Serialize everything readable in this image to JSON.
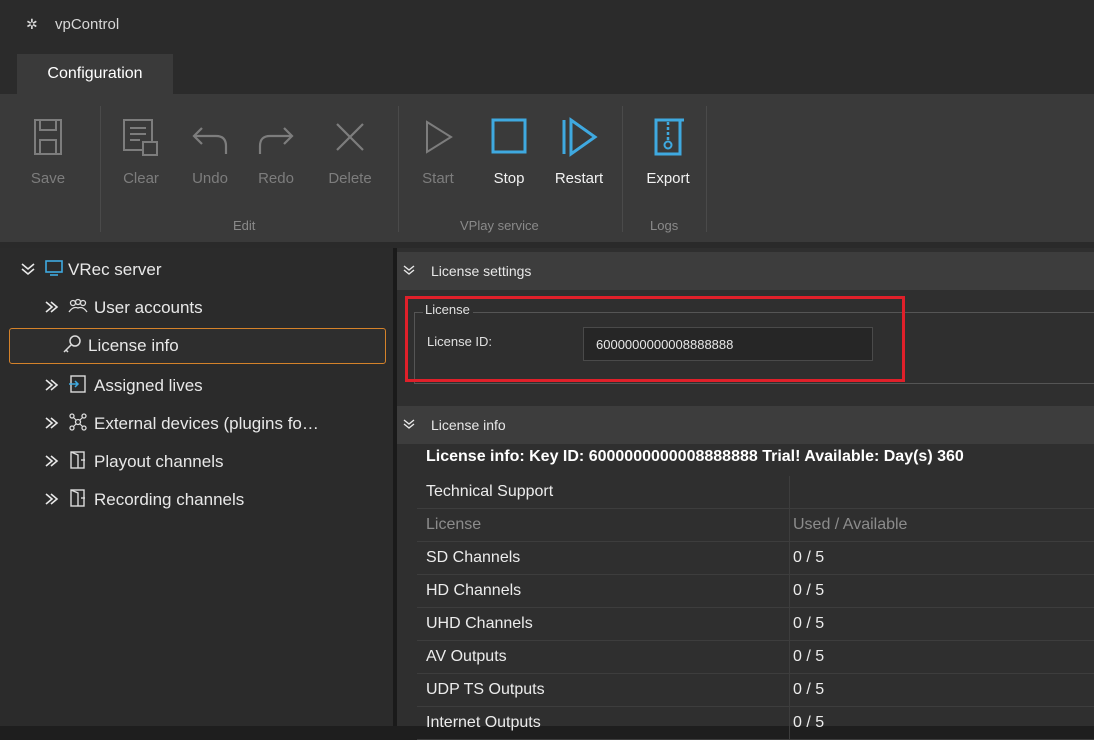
{
  "window": {
    "title": "vpControl"
  },
  "tabs": [
    {
      "label": "Configuration"
    }
  ],
  "ribbon": {
    "buttons": {
      "save": "Save",
      "clear": "Clear",
      "undo": "Undo",
      "redo": "Redo",
      "delete": "Delete",
      "start": "Start",
      "stop": "Stop",
      "restart": "Restart",
      "export": "Export"
    },
    "groups": {
      "edit": "Edit",
      "vplay": "VPlay service",
      "logs": "Logs"
    }
  },
  "tree": {
    "root": "VRec server",
    "items": [
      {
        "label": "User accounts",
        "icon": "users-icon"
      },
      {
        "label": "License info",
        "icon": "key-icon",
        "selected": true
      },
      {
        "label": "Assigned lives",
        "icon": "assign-icon"
      },
      {
        "label": "External devices (plugins fo…",
        "icon": "network-icon"
      },
      {
        "label": "Playout channels",
        "icon": "door-icon"
      },
      {
        "label": "Recording channels",
        "icon": "door-icon"
      }
    ]
  },
  "license_settings": {
    "header": "License settings",
    "group_title": "License",
    "id_label": "License ID:",
    "id_value": "6000000000008888888"
  },
  "license_info": {
    "header": "License info",
    "summary": "License info: Key ID: 6000000000008888888 Trial! Available: Day(s) 360",
    "support_label": "Technical Support",
    "columns": [
      "License",
      "Used / Available"
    ],
    "rows": [
      [
        "SD Channels",
        "0 / 5"
      ],
      [
        "HD Channels",
        "0 / 5"
      ],
      [
        "UHD Channels",
        "0 / 5"
      ],
      [
        "AV Outputs",
        "0 / 5"
      ],
      [
        "UDP TS Outputs",
        "0 / 5"
      ],
      [
        "Internet Outputs",
        "0 / 5"
      ]
    ]
  },
  "colors": {
    "selection_border": "#d4822a",
    "highlight_box": "#e0202a",
    "accent_icon": "#3fa9e0"
  }
}
